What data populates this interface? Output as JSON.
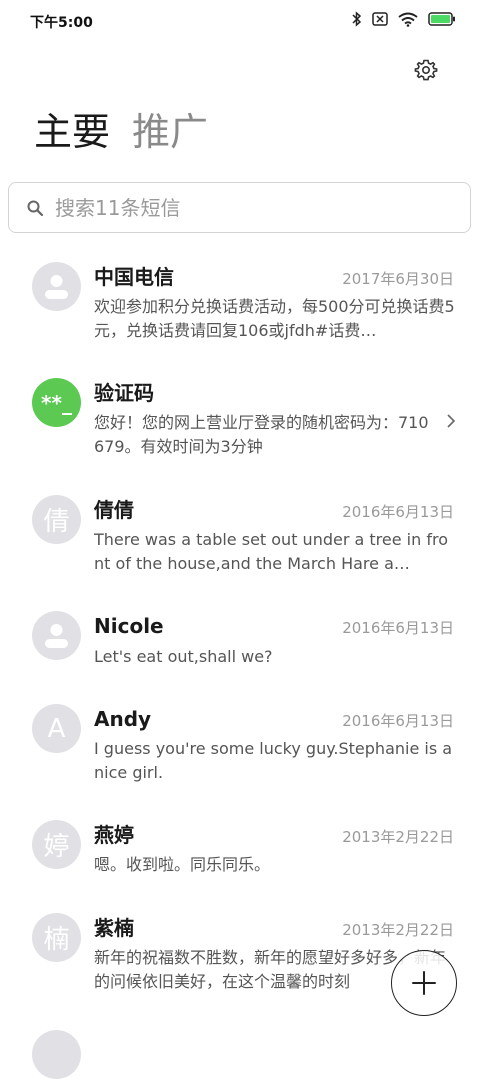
{
  "status_bar": {
    "time": "下午5:00"
  },
  "tabs": [
    {
      "label": "主要"
    },
    {
      "label": "推广"
    }
  ],
  "search": {
    "placeholder": "搜索11条短信"
  },
  "conversations": [
    {
      "name": "中国电信",
      "date": "2017年6月30日",
      "preview": "欢迎参加积分兑换话费活动，每500分可兑换话费5元，兑换话费请回复106或jfdh#话费…",
      "avatar": "person-icon"
    },
    {
      "name": "验证码",
      "date": "",
      "preview": "您好！您的网上营业厅登录的随机密码为：710679。有效时间为3分钟",
      "avatar_text": "**_",
      "avatar_color": "#5cc953"
    },
    {
      "name": "倩倩",
      "date": "2016年6月13日",
      "preview": "There was a table set out under a tree in front of the house,and the March Hare a…",
      "avatar_text": "倩"
    },
    {
      "name": "Nicole",
      "date": "2016年6月13日",
      "preview": "Let's eat out,shall we?",
      "avatar": "person-icon"
    },
    {
      "name": "Andy",
      "date": "2016年6月13日",
      "preview": "I guess you're some lucky guy.Stephanie is a nice girl.",
      "avatar_text": "A"
    },
    {
      "name": "燕婷",
      "date": "2013年2月22日",
      "preview": "嗯。收到啦。同乐同乐。",
      "avatar_text": "婷"
    },
    {
      "name": "紫楠",
      "date": "2013年2月22日",
      "preview": "新年的祝福数不胜数，新年的愿望好多好多，新年的问候依旧美好，在这个温馨的时刻",
      "avatar_text": "楠"
    }
  ],
  "colors": {
    "avatar_gray": "#e1e1e5",
    "accent_green": "#5cc953",
    "battery_green": "#4cd964"
  }
}
